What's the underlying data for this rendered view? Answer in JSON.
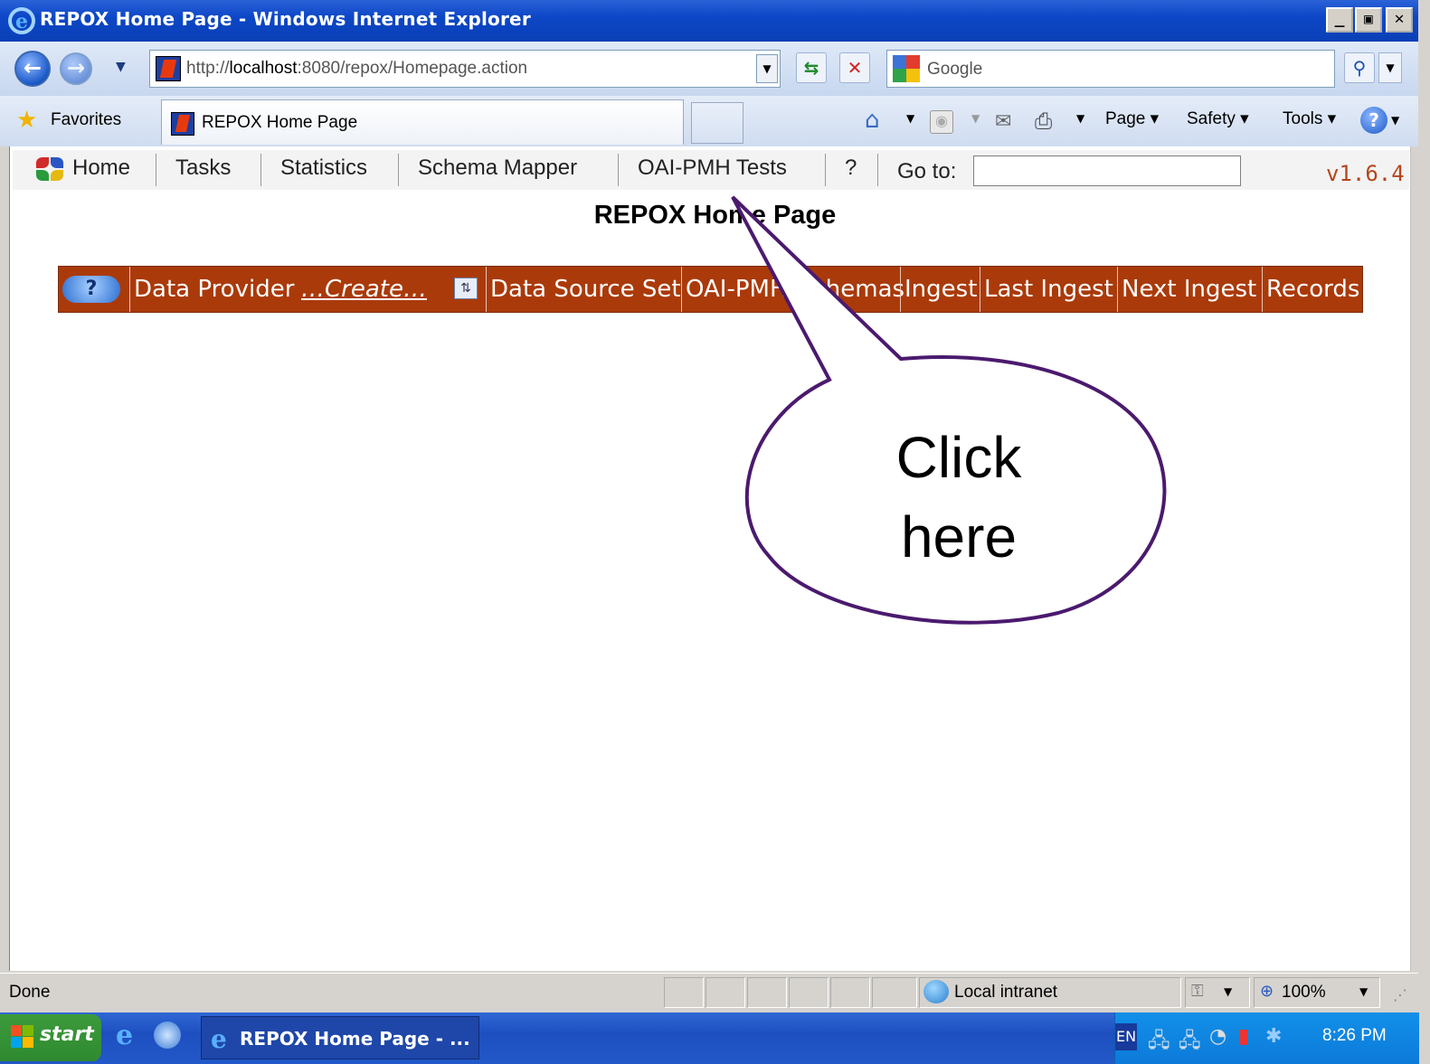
{
  "window": {
    "title": "REPOX Home Page - Windows Internet Explorer",
    "minimize": "_",
    "maximize": "▣",
    "close": "✕"
  },
  "browser": {
    "address_prefix": "http://",
    "address_host": "localhost",
    "address_rest": ":8080/repox/Homepage.action",
    "search_placeholder": "Google",
    "favorites_label": "Favorites",
    "tab_title": "REPOX Home Page",
    "commands": {
      "page": "Page ▾",
      "safety": "Safety ▾",
      "tools": "Tools ▾"
    }
  },
  "app_menu": {
    "items": [
      "Home",
      "Tasks",
      "Statistics",
      "Schema Mapper",
      "OAI-PMH Tests",
      "?"
    ],
    "goto_label": "Go to:",
    "goto_value": "",
    "version": "v1.6.4"
  },
  "page": {
    "heading": "REPOX Home Page"
  },
  "table": {
    "help_icon": "?",
    "columns": [
      "Data Provider",
      "…Create…",
      "Data Source Set",
      "OAI-PMH",
      "Schemas",
      "Ingest",
      "Last Ingest",
      "Next Ingest",
      "Records"
    ]
  },
  "callout": {
    "line1": "Click",
    "line2": "here"
  },
  "status": {
    "text": "Done",
    "zone": "Local intranet",
    "zoom": "100%"
  },
  "taskbar": {
    "start_label": "start",
    "task_label": "REPOX Home Page - ...",
    "language": "EN",
    "clock": "8:26 PM"
  },
  "colors": {
    "table_header": "#aa3a0a",
    "version": "#b5461b",
    "callout_outline": "#4b1a6e",
    "titlebar": "#0d47c7"
  }
}
